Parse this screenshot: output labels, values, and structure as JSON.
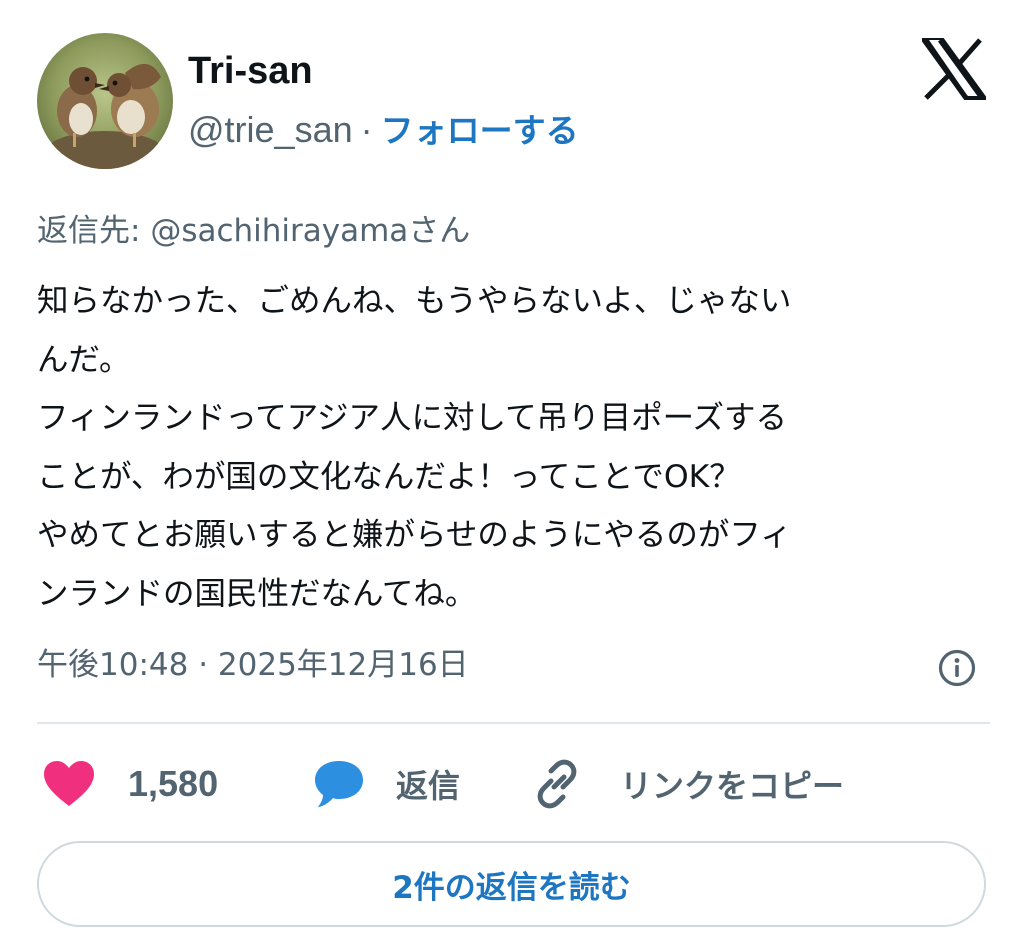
{
  "author": {
    "display_name": "Tri-san",
    "handle": "@trie_san",
    "separator": "·",
    "follow_label": "フォローする",
    "avatar_icon": "sparrows-avatar"
  },
  "platform": {
    "logo_icon": "x-logo-icon"
  },
  "reply_to": {
    "prefix": "返信先:",
    "mention": "@sachihirayamaさん"
  },
  "tweet": {
    "lines": [
      "知らなかった、ごめんね、もうやらないよ、じゃない",
      "んだ。",
      "フィンランドってアジア人に対して吊り目ポーズする",
      "ことが、わが国の文化なんだよ！ってことでOK？",
      "やめてとお願いすると嫌がらせのようにやるのがフィ",
      "ンランドの国民性だなんてね。"
    ]
  },
  "meta": {
    "timestamp": "午後10:48 · 2025年12月16日",
    "info_icon": "info-icon"
  },
  "actions": {
    "like_count": "1,580",
    "reply_label": "返信",
    "copy_link_label": "リンクをコピー"
  },
  "read_replies_label": "2件の返信を読む",
  "colors": {
    "accent": "#1d76c2",
    "like": "#f0307f",
    "reply_bubble": "#2c8fe0",
    "text_primary": "#0f1419",
    "text_secondary": "#536471",
    "border": "#cfd9de"
  }
}
